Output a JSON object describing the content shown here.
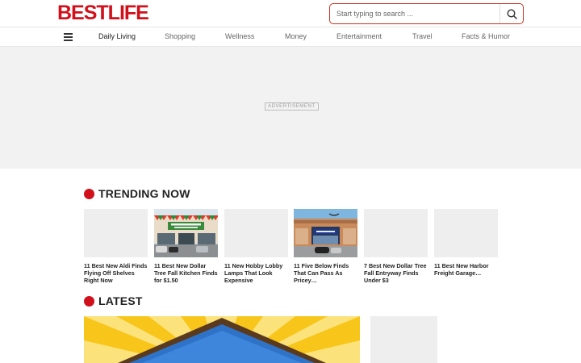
{
  "header": {
    "logo_text": "BESTLIFE",
    "search_placeholder": "Start typing to search ...",
    "brand_color": "#d0111b"
  },
  "nav": {
    "items": [
      {
        "label": "Daily Living",
        "active": true
      },
      {
        "label": "Shopping"
      },
      {
        "label": "Wellness"
      },
      {
        "label": "Money"
      },
      {
        "label": "Entertainment"
      },
      {
        "label": "Travel"
      },
      {
        "label": "Facts & Humor"
      }
    ]
  },
  "ad": {
    "label": "ADVERTISEMENT"
  },
  "trending": {
    "title": "TRENDING NOW",
    "cards": [
      {
        "caption": "11 Best New Aldi Finds Flying Off Shelves Right Now",
        "image": "placeholder"
      },
      {
        "caption": "11 Best New Dollar Tree Fall Kitchen Finds for $1.50",
        "image": "dollar-tree-storefront"
      },
      {
        "caption": "11 New Hobby Lobby Lamps That Look Expensive",
        "image": "placeholder"
      },
      {
        "caption": "11 Five Below Finds That Can Pass As Pricey…",
        "image": "five-below-storefront"
      },
      {
        "caption": "7 Best New Dollar Tree Fall Entryway Finds Under $3",
        "image": "placeholder"
      },
      {
        "caption": "11 Best New Harbor Freight Garage…",
        "image": "placeholder"
      }
    ]
  },
  "latest": {
    "title": "LATEST"
  }
}
